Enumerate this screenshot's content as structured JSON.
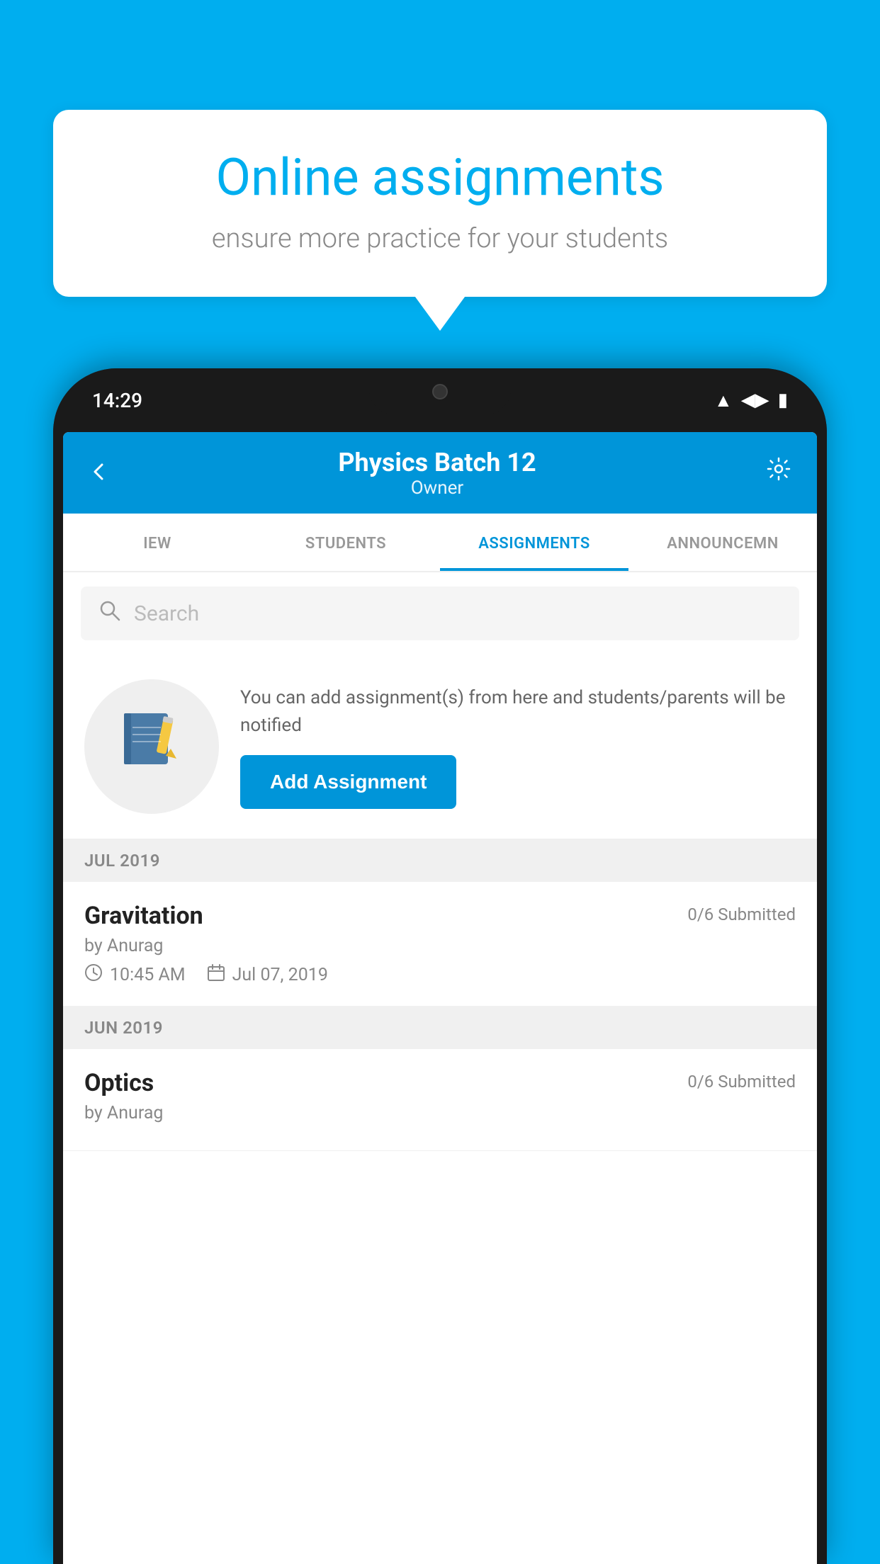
{
  "background_color": "#00AEEF",
  "speech_bubble": {
    "title": "Online assignments",
    "subtitle": "ensure more practice for your students"
  },
  "phone": {
    "status_bar": {
      "time": "14:29",
      "wifi_icon": "▼",
      "signal_icon": "▲",
      "battery_icon": "▮"
    },
    "header": {
      "title": "Physics Batch 12",
      "subtitle": "Owner",
      "back_icon": "←",
      "settings_icon": "⚙"
    },
    "tabs": [
      {
        "label": "IEW",
        "active": false
      },
      {
        "label": "STUDENTS",
        "active": false
      },
      {
        "label": "ASSIGNMENTS",
        "active": true
      },
      {
        "label": "ANNOUNCEMENTS",
        "active": false
      }
    ],
    "search": {
      "placeholder": "Search",
      "icon": "🔍"
    },
    "add_assignment_section": {
      "description": "You can add assignment(s) from here and students/parents will be notified",
      "button_label": "Add Assignment",
      "notebook_icon": "📓"
    },
    "assignment_sections": [
      {
        "date_label": "JUL 2019",
        "assignments": [
          {
            "name": "Gravitation",
            "submitted": "0/6 Submitted",
            "by": "by Anurag",
            "time": "10:45 AM",
            "date": "Jul 07, 2019"
          }
        ]
      },
      {
        "date_label": "JUN 2019",
        "assignments": [
          {
            "name": "Optics",
            "submitted": "0/6 Submitted",
            "by": "by Anurag",
            "time": "",
            "date": ""
          }
        ]
      }
    ]
  }
}
